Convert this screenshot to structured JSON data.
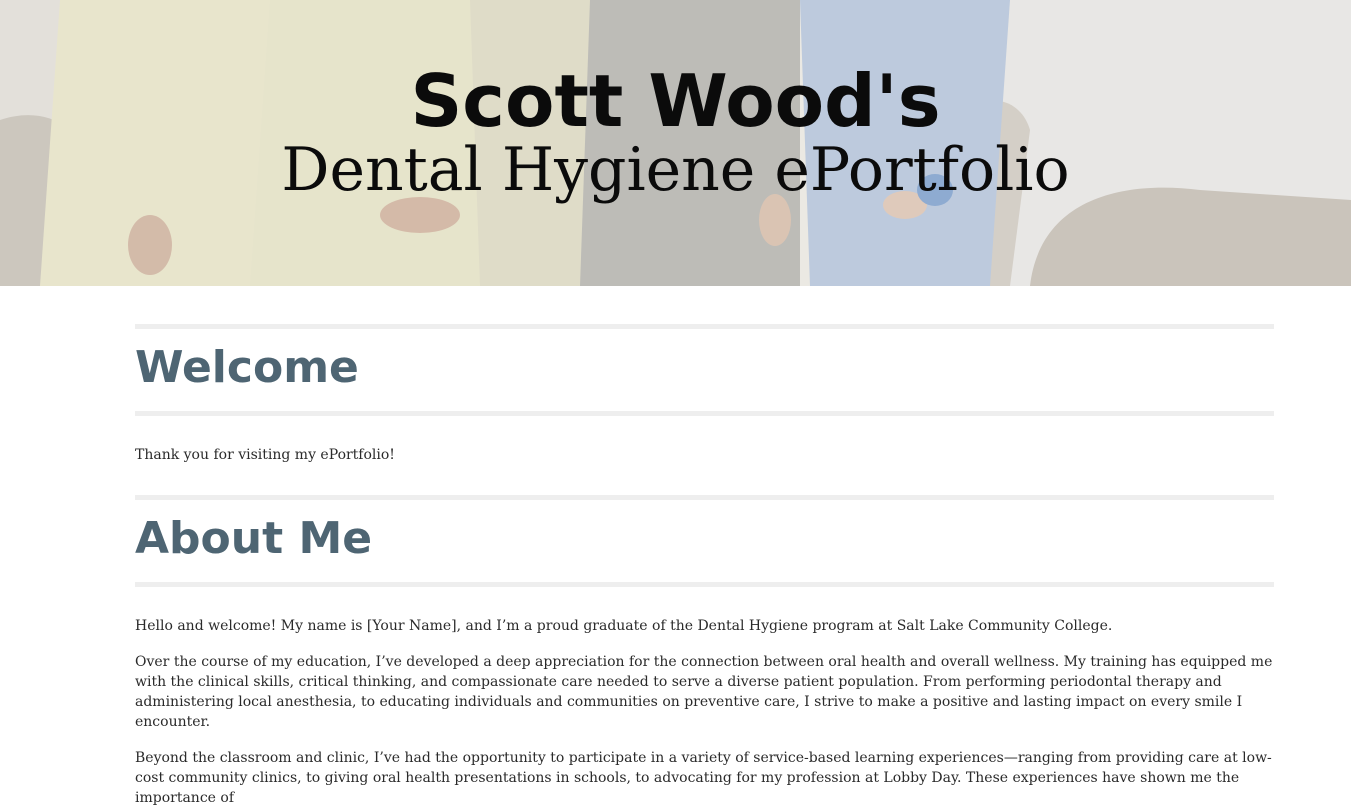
{
  "hero": {
    "title": "Scott Wood's",
    "subtitle": "Dental Hygiene ePortfolio"
  },
  "colors": {
    "heading": "#4e6573",
    "rule": "#eeeeee",
    "hero_text": "#0b0b0b"
  },
  "sections": {
    "welcome": {
      "heading": "Welcome",
      "text": "Thank you for visiting my ePortfolio!"
    },
    "about": {
      "heading": "About Me",
      "p1": "Hello and welcome! My name is [Your Name], and I’m a proud graduate of the Dental Hygiene program at Salt Lake Community College.",
      "p2": "Over the course of my education, I’ve developed a deep appreciation for the connection between oral health and overall wellness. My training has equipped me with the clinical skills, critical thinking, and compassionate care needed to serve a diverse patient population. From performing periodontal therapy and administering local anesthesia, to educating individuals and communities on preventive care, I strive to make a positive and lasting impact on every smile I encounter.",
      "p3": "Beyond the classroom and clinic, I’ve had the opportunity to participate in a variety of service-based learning experiences—ranging from providing care at low-cost community clinics, to giving oral health presentations in schools, to advocating for my profession at Lobby Day. These experiences have shown me the importance of"
    }
  }
}
